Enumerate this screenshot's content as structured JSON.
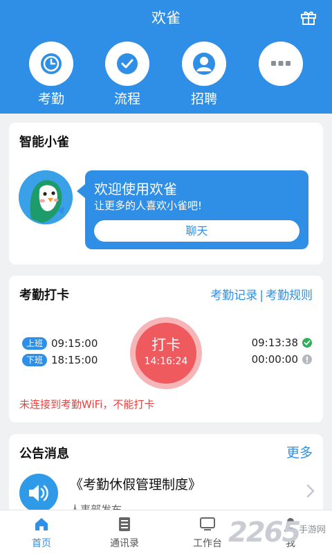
{
  "header": {
    "title": "欢雀"
  },
  "quick_actions": [
    {
      "label": "考勤",
      "icon": "clock-icon"
    },
    {
      "label": "流程",
      "icon": "check-circle-icon"
    },
    {
      "label": "招聘",
      "icon": "person-icon"
    },
    {
      "label": "",
      "icon": "more-dots-icon"
    }
  ],
  "assistant": {
    "title": "智能小雀",
    "bubble_title": "欢迎使用欢雀",
    "bubble_subtitle": "让更多的人喜欢小雀吧!",
    "chat_button": "聊天"
  },
  "attendance": {
    "title": "考勤打卡",
    "record_link": "考勤记录",
    "separator": "|",
    "rules_link": "考勤规则",
    "on_tag": "上班",
    "on_time": "09:15:00",
    "off_tag": "下班",
    "off_time": "18:15:00",
    "punch_label": "打卡",
    "punch_time": "14:16:24",
    "on_record": "09:13:38",
    "off_record": "00:00:00",
    "warning": "未连接到考勤WiFi，不能打卡"
  },
  "announcements": {
    "title": "公告消息",
    "more": "更多",
    "item_title": "《考勤休假管理制度》",
    "item_subtitle": "人事部发布"
  },
  "tabbar": [
    {
      "label": "首页",
      "active": true
    },
    {
      "label": "通讯录",
      "active": false
    },
    {
      "label": "工作台",
      "active": false
    },
    {
      "label": "我",
      "active": false
    }
  ],
  "watermark": {
    "big": "2265",
    "small": "手游网"
  },
  "colors": {
    "primary": "#2f8fe6",
    "punch": "#ef5a5f",
    "warning": "#e8423f",
    "ok": "#2fb05d"
  }
}
